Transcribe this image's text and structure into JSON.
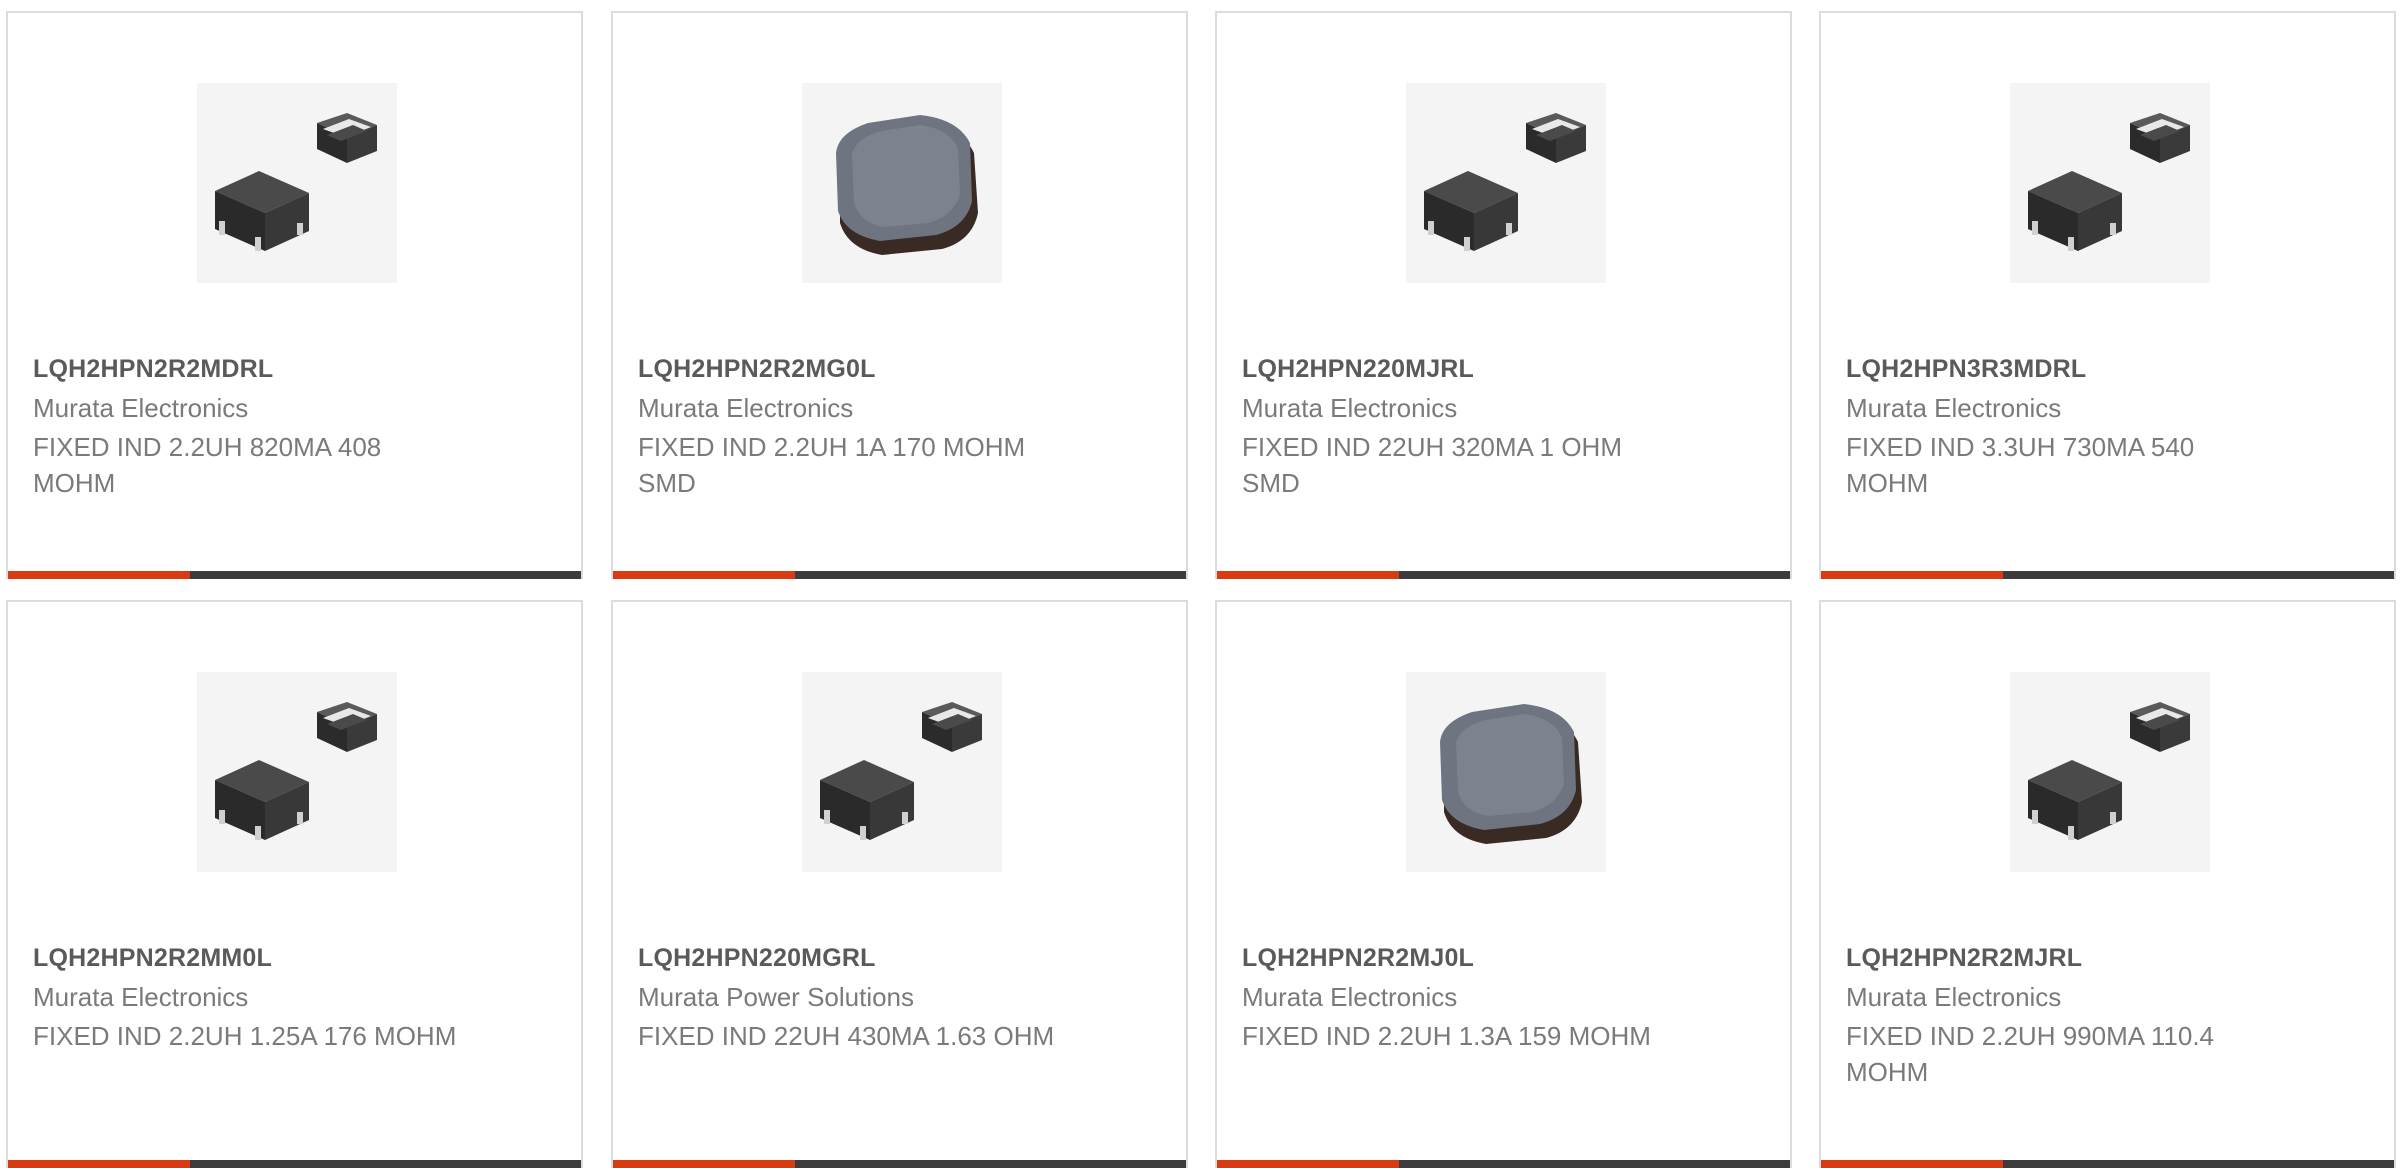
{
  "accent_color": "#d83a12",
  "bar_color": "#3c3c3c",
  "products": [
    {
      "part_number": "LQH2HPN2R2MDRL",
      "manufacturer": "Murata Electronics",
      "description": "FIXED IND 2.2UH 820MA 408 MOHM",
      "image_icon": "dual-inductor-icon"
    },
    {
      "part_number": "LQH2HPN2R2MG0L",
      "manufacturer": "Murata Electronics",
      "description": "FIXED IND 2.2UH 1A 170 MOHM SMD",
      "image_icon": "shielded-inductor-icon"
    },
    {
      "part_number": "LQH2HPN220MJRL",
      "manufacturer": "Murata Electronics",
      "description": "FIXED IND 22UH 320MA 1 OHM SMD",
      "image_icon": "dual-inductor-icon"
    },
    {
      "part_number": "LQH2HPN3R3MDRL",
      "manufacturer": "Murata Electronics",
      "description": "FIXED IND 3.3UH 730MA 540 MOHM",
      "image_icon": "dual-inductor-icon"
    },
    {
      "part_number": "LQH2HPN2R2MM0L",
      "manufacturer": "Murata Electronics",
      "description": "FIXED IND 2.2UH 1.25A 176 MOHM",
      "image_icon": "dual-inductor-icon"
    },
    {
      "part_number": "LQH2HPN220MGRL",
      "manufacturer": "Murata Power Solutions",
      "description": "FIXED IND 22UH 430MA 1.63 OHM",
      "image_icon": "dual-inductor-icon"
    },
    {
      "part_number": "LQH2HPN2R2MJ0L",
      "manufacturer": "Murata Electronics",
      "description": "FIXED IND 2.2UH 1.3A 159 MOHM",
      "image_icon": "shielded-inductor-icon"
    },
    {
      "part_number": "LQH2HPN2R2MJRL",
      "manufacturer": "Murata Electronics",
      "description": "FIXED IND 2.2UH 990MA 110.4 MOHM",
      "image_icon": "dual-inductor-icon"
    }
  ]
}
